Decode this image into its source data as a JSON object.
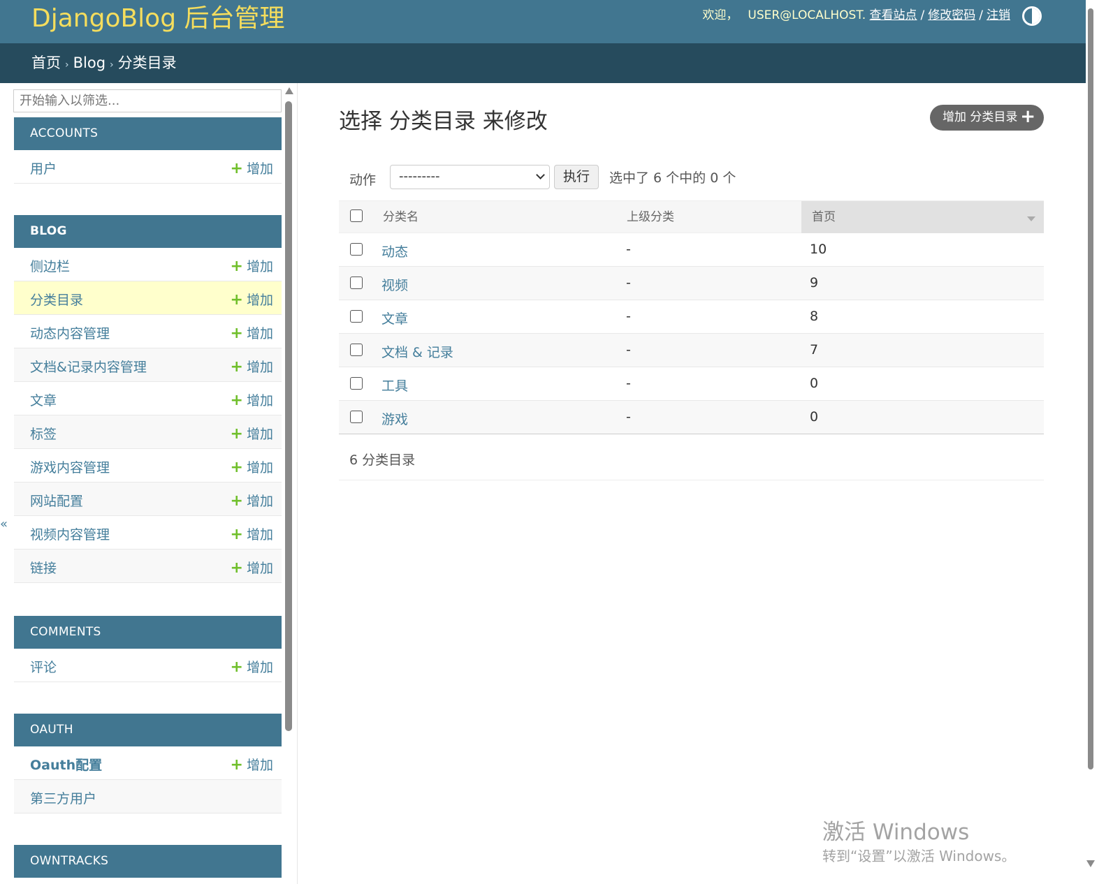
{
  "header": {
    "branding": "DjangoBlog 后台管理",
    "welcome": "欢迎，",
    "username": "user@localhost.",
    "view_site": "查看站点",
    "change_password": "修改密码",
    "logout": "注销",
    "sep": "/"
  },
  "breadcrumbs": {
    "home": "首页",
    "app": "Blog",
    "current": "分类目录",
    "arrow": "›"
  },
  "sidebar": {
    "filter_placeholder": "开始输入以筛选...",
    "toggle": "«",
    "add_label": "增加",
    "modules": [
      {
        "caption": "ACCOUNTS",
        "items": [
          {
            "name": "用户",
            "has_add": true
          }
        ]
      },
      {
        "caption": "BLOG",
        "items": [
          {
            "name": "侧边栏",
            "has_add": true
          },
          {
            "name": "分类目录",
            "has_add": true
          },
          {
            "name": "动态内容管理",
            "has_add": true
          },
          {
            "name": "文档&记录内容管理",
            "has_add": true
          },
          {
            "name": "文章",
            "has_add": true
          },
          {
            "name": "标签",
            "has_add": true
          },
          {
            "name": "游戏内容管理",
            "has_add": true
          },
          {
            "name": "网站配置",
            "has_add": true
          },
          {
            "name": "视频内容管理",
            "has_add": true
          },
          {
            "name": "链接",
            "has_add": true
          }
        ]
      },
      {
        "caption": "COMMENTS",
        "items": [
          {
            "name": "评论",
            "has_add": true
          }
        ]
      },
      {
        "caption": "OAUTH",
        "items": [
          {
            "name": "Oauth配置",
            "has_add": true
          },
          {
            "name": "第三方用户",
            "has_add": false
          }
        ]
      },
      {
        "caption": "OWNTRACKS",
        "items": []
      }
    ]
  },
  "main": {
    "title": "选择 分类目录 来修改",
    "add_button": "增加 分类目录",
    "add_plus": "+",
    "actions": {
      "label": "动作",
      "selected": "---------",
      "go": "执行",
      "counter": "选中了 6 个中的 0 个"
    },
    "table": {
      "headers": [
        "分类名",
        "上级分类",
        "首页"
      ],
      "rows": [
        {
          "name": "动态",
          "parent": "-",
          "index": "10"
        },
        {
          "name": "视频",
          "parent": "-",
          "index": "9"
        },
        {
          "name": "文章",
          "parent": "-",
          "index": "8"
        },
        {
          "name": "文档 & 记录",
          "parent": "-",
          "index": "7"
        },
        {
          "name": "工具",
          "parent": "-",
          "index": "0"
        },
        {
          "name": "游戏",
          "parent": "-",
          "index": "0"
        }
      ]
    },
    "paginator": "6 分类目录"
  },
  "watermark": {
    "line1": "激活 Windows",
    "line2": "转到“设置”以激活 Windows。"
  },
  "colors": {
    "header_bg": "#417690",
    "breadcrumb_bg": "#264b5d",
    "branding": "#f5dd5d",
    "link": "#447e9b",
    "add_plus": "#70bf2b",
    "current_row": "#ffffcc"
  }
}
